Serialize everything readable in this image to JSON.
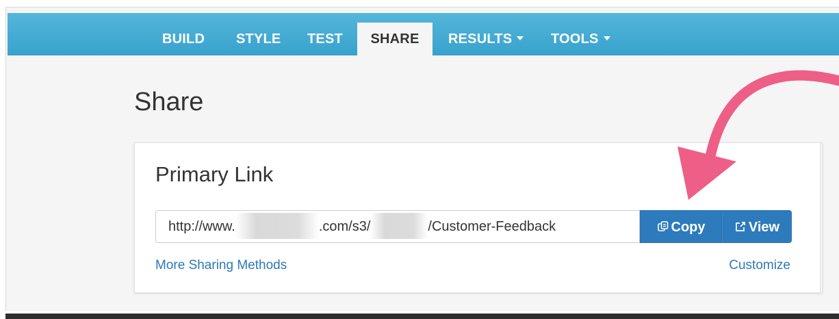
{
  "nav": {
    "items": [
      {
        "label": "BUILD"
      },
      {
        "label": "STYLE"
      },
      {
        "label": "TEST"
      },
      {
        "label": "SHARE",
        "active": true
      },
      {
        "label": "RESULTS",
        "dropdown": true
      },
      {
        "label": "TOOLS",
        "dropdown": true
      }
    ]
  },
  "page": {
    "title": "Share"
  },
  "primary_link": {
    "title": "Primary Link",
    "url_prefix": "http://www.",
    "url_middle": ".com/s3/",
    "url_suffix": "/Customer-Feedback",
    "copy_label": "Copy",
    "view_label": "View",
    "more_methods_label": "More Sharing Methods",
    "customize_label": "Customize"
  },
  "icons": {
    "copy": "copy-icon",
    "view": "external-link-icon",
    "dropdown": "caret-down-icon"
  },
  "colors": {
    "nav_bg": "#3ea9d1",
    "button_bg": "#2d7bbd",
    "link": "#2d78b8",
    "annotation_arrow": "#ee5f87"
  }
}
